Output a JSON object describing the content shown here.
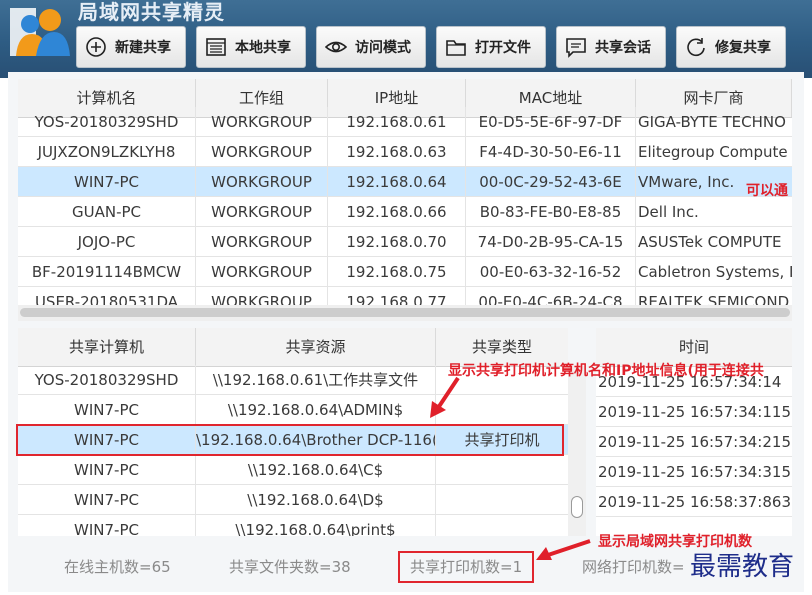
{
  "app": {
    "title": "局域网共享精灵"
  },
  "toolbar": [
    {
      "label": "新建共享",
      "icon": "plus-circle-icon",
      "name": "new-share-button"
    },
    {
      "label": "本地共享",
      "icon": "window-icon",
      "name": "local-share-button"
    },
    {
      "label": "访问模式",
      "icon": "eye-icon",
      "name": "access-mode-button"
    },
    {
      "label": "打开文件",
      "icon": "folder-icon",
      "name": "open-file-button"
    },
    {
      "label": "共享会话",
      "icon": "chat-icon",
      "name": "share-session-button"
    },
    {
      "label": "修复共享",
      "icon": "refresh-icon",
      "name": "repair-share-button"
    }
  ],
  "computers": {
    "columns": [
      "计算机名",
      "工作组",
      "IP地址",
      "MAC地址",
      "网卡厂商"
    ],
    "rows": [
      [
        "YOS-20180329SHD",
        "WORKGROUP",
        "192.168.0.61",
        "E0-D5-5E-6F-97-DF",
        "GIGA-BYTE TECHNO"
      ],
      [
        "JUJXZON9LZKLYH8",
        "WORKGROUP",
        "192.168.0.63",
        "F4-4D-30-50-E6-11",
        "Elitegroup Compute"
      ],
      [
        "WIN7-PC",
        "WORKGROUP",
        "192.168.0.64",
        "00-0C-29-52-43-6E",
        "VMware, Inc."
      ],
      [
        "GUAN-PC",
        "WORKGROUP",
        "192.168.0.66",
        "B0-83-FE-B0-E8-85",
        "Dell Inc."
      ],
      [
        "JOJO-PC",
        "WORKGROUP",
        "192.168.0.70",
        "74-D0-2B-95-CA-15",
        "ASUSTek COMPUTE"
      ],
      [
        "BF-20191114BMCW",
        "WORKGROUP",
        "192.168.0.75",
        "00-E0-63-32-16-52",
        "Cabletron Systems, I"
      ],
      [
        "USER-20180531DA",
        "WORKGROUP",
        "192.168.0.77",
        "00-E0-4C-6B-24-C8",
        "REALTEK SEMICOND"
      ]
    ],
    "selected_row": 2
  },
  "shares": {
    "columns": [
      "共享计算机",
      "共享资源",
      "共享类型"
    ],
    "rows": [
      [
        "YOS-20180329SHD",
        "\\\\192.168.0.61\\工作共享文件",
        ""
      ],
      [
        "WIN7-PC",
        "\\\\192.168.0.64\\ADMIN$",
        ""
      ],
      [
        "WIN7-PC",
        "\\192.168.0.64\\Brother DCP-116(",
        "共享打印机"
      ],
      [
        "WIN7-PC",
        "\\\\192.168.0.64\\C$",
        ""
      ],
      [
        "WIN7-PC",
        "\\\\192.168.0.64\\D$",
        ""
      ],
      [
        "WIN7-PC",
        "\\\\192.168.0.64\\print$",
        ""
      ]
    ],
    "selected_row": 2
  },
  "sessions": {
    "column": "时间",
    "rows": [
      "2019-11-25 16:57:34:14",
      "2019-11-25 16:57:34:115",
      "2019-11-25 16:57:34:215",
      "2019-11-25 16:57:34:315",
      "2019-11-25 16:58:37:863"
    ]
  },
  "status": {
    "online_hosts": "在线主机数=65",
    "shared_folders": "共享文件夹数=38",
    "shared_printers": "共享打印机数=1",
    "network_printers": "网络打印机数="
  },
  "annotations": {
    "side_note": "可以通",
    "printer_note": "显示共享打印机计算机名和IP地址信息(用于连接共",
    "count_note": "显示局域网共享打印机数"
  },
  "watermark": "最需教育",
  "colors": {
    "header": "#2e5c83",
    "selection": "#cce8ff",
    "annotation": "#e0202a",
    "watermark": "#1e2d8a"
  }
}
